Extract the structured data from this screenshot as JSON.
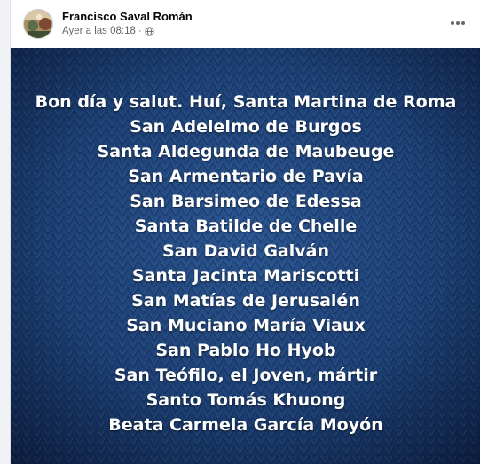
{
  "post": {
    "author": "Francisco Saval Román",
    "timestamp": "Ayer a las 08:18",
    "separator": "·",
    "privacy_icon": "globe-icon",
    "more_icon": "more-options-icon"
  },
  "image": {
    "lines": [
      "Bon día y salut. Huí, Santa Martina de Roma",
      "San Adelelmo de Burgos",
      "Santa Aldegunda de Maubeuge",
      "San Armentario de Pavía",
      "San Barsimeo de Edessa",
      "Santa Batilde de Chelle",
      "San David Galván",
      "Santa Jacinta Mariscotti",
      "San Matías de Jerusalén",
      "San Muciano María Viaux",
      "San Pablo Ho Hyob",
      "San Teófilo, el Joven, mártir",
      "Santo Tomás Khuong",
      "Beata Carmela García Moyón"
    ],
    "background_colors": [
      "#0b1a38",
      "#1c3f73",
      "#2a5590"
    ],
    "text_color": "#ffffff"
  }
}
